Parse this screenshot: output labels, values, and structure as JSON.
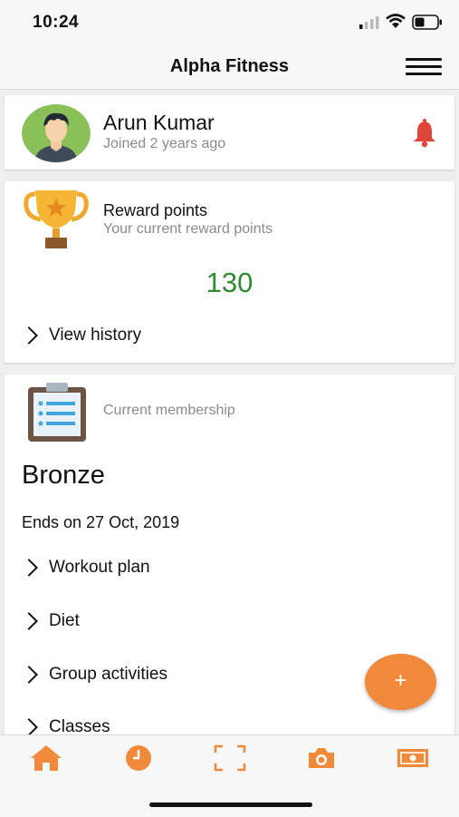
{
  "status_bar": {
    "time": "10:24"
  },
  "header": {
    "title": "Alpha Fitness"
  },
  "profile": {
    "name": "Arun Kumar",
    "joined": "Joined 2 years ago"
  },
  "rewards": {
    "title": "Reward points",
    "subtitle": "Your current reward points",
    "points": "130",
    "history_label": "View history"
  },
  "membership": {
    "label": "Current membership",
    "level": "Bronze",
    "ends": "Ends on 27 Oct, 2019",
    "links": [
      "Workout plan",
      "Diet",
      "Group activities",
      "Classes"
    ]
  },
  "fab": {
    "label": "+"
  },
  "tabs": [
    "home-icon",
    "clock-icon",
    "scan-icon",
    "camera-icon",
    "money-icon"
  ],
  "colors": {
    "accent": "#f08a3a",
    "points": "#2e8b2e",
    "bell": "#e0453a"
  }
}
